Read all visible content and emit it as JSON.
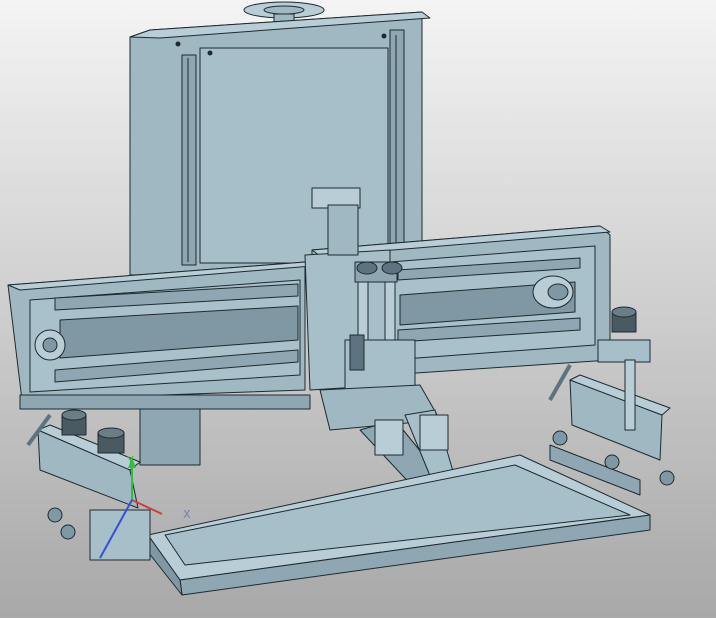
{
  "viewport": {
    "title": "",
    "background_top": "#f5f5f5",
    "background_bottom": "#a9a9a9",
    "model_fill": "#9fb8c2",
    "model_fill_dark": "#7f98a3",
    "model_fill_light": "#b8cdd5",
    "edge_color": "#1e2a30"
  },
  "triad": {
    "y_label": "Y",
    "x_label": "X",
    "y_color": "#2fbf3a",
    "x_color": "#d83a3a",
    "z_color": "#3a4fd8"
  }
}
